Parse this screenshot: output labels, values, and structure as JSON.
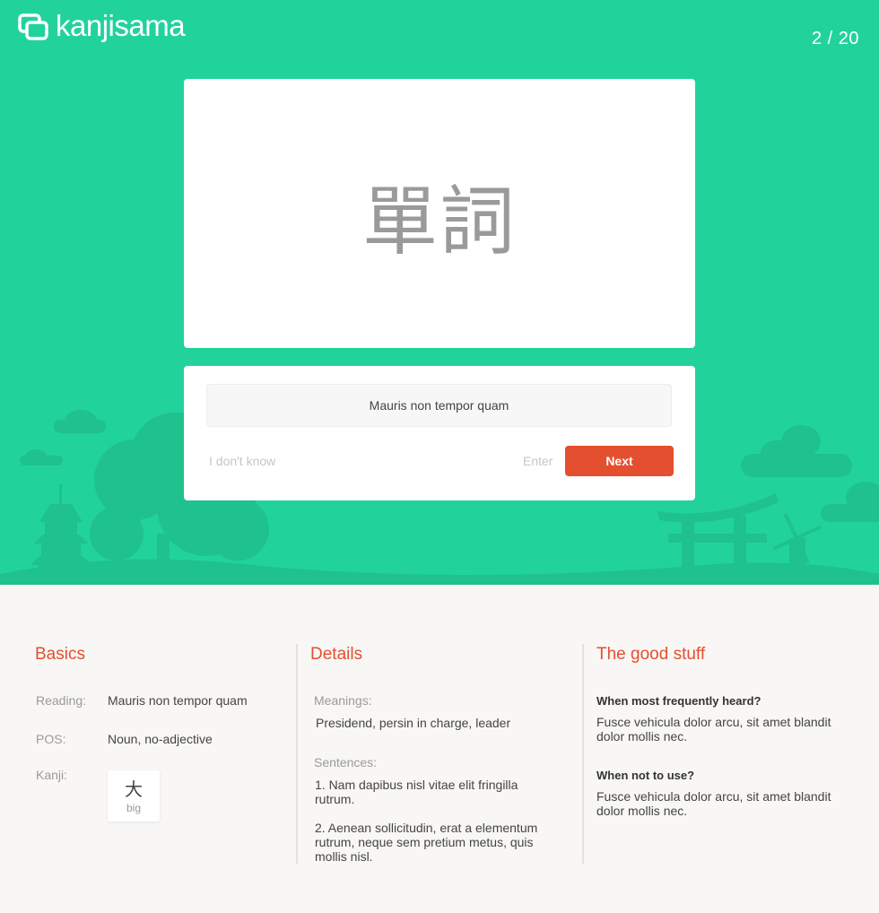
{
  "header": {
    "app_name": "kanjisama",
    "progress": "2 / 20",
    "colors": {
      "brand_green": "#21d39a",
      "accent_red": "#e44f2f"
    }
  },
  "card": {
    "word": "單詞"
  },
  "answer": {
    "input_value": "Mauris non tempor quam",
    "dont_know_label": "I don't know",
    "enter_hint": "Enter",
    "next_label": "Next"
  },
  "basics": {
    "title": "Basics",
    "reading_label": "Reading:",
    "reading_value": "Mauris non tempor quam",
    "pos_label": "POS:",
    "pos_value": "Noun, no-adjective",
    "kanji_label": "Kanji:",
    "kanji_items": [
      {
        "char": "大",
        "meaning": "big"
      }
    ]
  },
  "details": {
    "title": "Details",
    "meanings_label": "Meanings:",
    "meanings_value": "Presidend, persin in charge, leader",
    "sentences_label": "Sentences:",
    "sentences": [
      "1. Nam dapibus nisl vitae elit fringilla rutrum.",
      "2. Aenean sollicitudin, erat a elementum rutrum, neque sem pretium metus, quis mollis nisl."
    ]
  },
  "good_stuff": {
    "title": "The good stuff",
    "q1": "When most frequently heard?",
    "a1": "Fusce vehicula dolor arcu, sit amet blandit dolor mollis nec.",
    "q2": "When not to use?",
    "a2": "Fusce vehicula dolor arcu, sit amet blandit dolor mollis nec."
  }
}
